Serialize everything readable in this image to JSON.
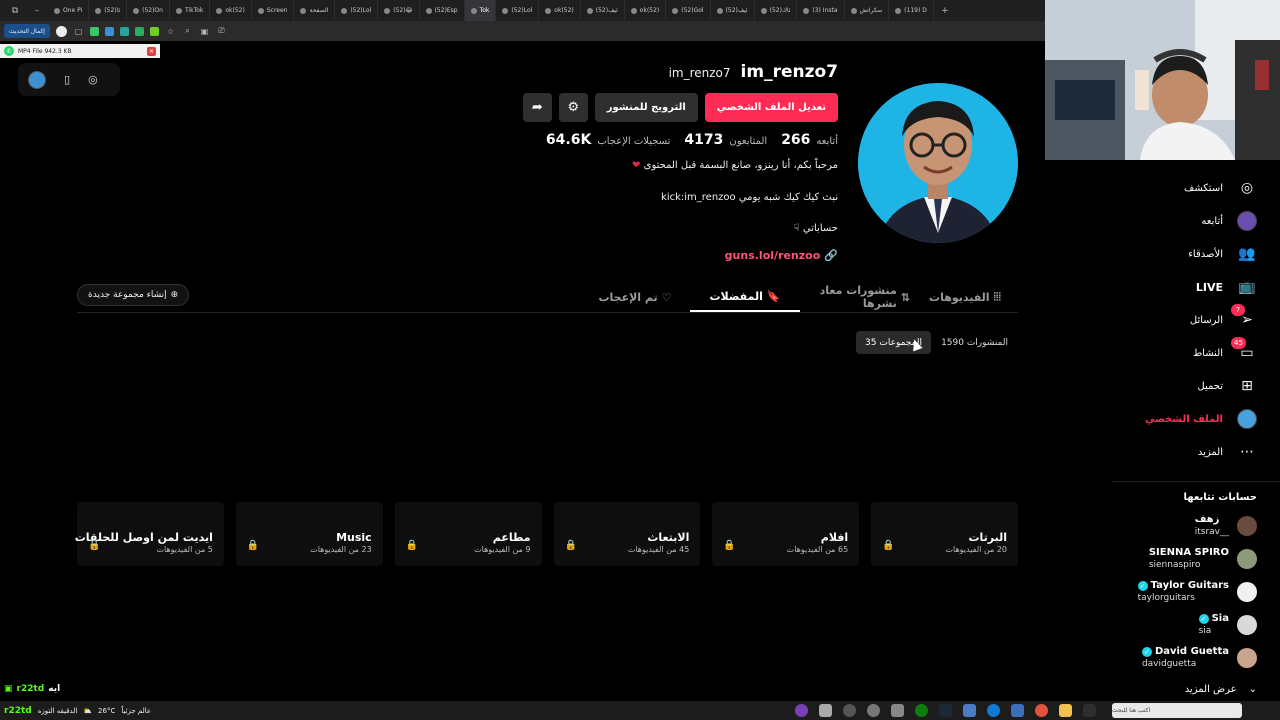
{
  "browser": {
    "tabs": [
      {
        "label": "One Pi"
      },
      {
        "label": "(52)ئا"
      },
      {
        "label": "(52)On"
      },
      {
        "label": "TikTok"
      },
      {
        "label": "ok(52)"
      },
      {
        "label": "Screen"
      },
      {
        "label": "الصفحة"
      },
      {
        "label": "(52)Lol"
      },
      {
        "label": "(52)😂"
      },
      {
        "label": "(52)Esp"
      },
      {
        "label": "Tok",
        "active": true
      },
      {
        "label": "(52)Lol"
      },
      {
        "label": "ok(52)"
      },
      {
        "label": "(52)ئيف"
      },
      {
        "label": "ok(52)"
      },
      {
        "label": "(52)Gol"
      },
      {
        "label": "(52)ئيف"
      },
      {
        "label": "(52)ئاك"
      },
      {
        "label": "(3) Insta"
      },
      {
        "label": "سكراتش"
      },
      {
        "label": "(119) D"
      }
    ],
    "update_label": "إكمال التحديث",
    "download_label": "MP4 File 942.3 KB"
  },
  "profile": {
    "username": "im_renzo7",
    "display_name": "im_renzo7",
    "edit_profile": "تعديل الملف الشخصي",
    "promote_post": "الترويج للمنشور",
    "stats": {
      "following_count": "266",
      "following_label": "أتابعه",
      "followers_count": "4173",
      "followers_label": "المتابعون",
      "likes_count": "64.6K",
      "likes_label": "تسجيلات الإعجاب"
    },
    "bio": {
      "line1": "مرحباً بكم، أنا رينزو، صانع البسمة قبل المحتوى",
      "line2": "نبث كيك كيك شبه يومي kick:im_renzoo",
      "line3": "حساباتي",
      "link": "guns.lol/renzoo"
    }
  },
  "tabs": {
    "videos": "الفيديوهات",
    "reposts": "منشورات معاد نشرها",
    "favorites": "المفضلات",
    "liked": "تم الإعجاب"
  },
  "new_collection": "إنشاء مجموعة جديدة",
  "filters": {
    "posts": "المنشورات 1590",
    "collections": "المجموعات 35"
  },
  "collections": [
    {
      "title": "البرتات",
      "count": "20 من الفيديوهات"
    },
    {
      "title": "افلام",
      "count": "65 من الفيديوهات"
    },
    {
      "title": "الابتعاث",
      "count": "45 من الفيديوهات"
    },
    {
      "title": "مطاعم",
      "count": "9 من الفيديوهات"
    },
    {
      "title": "Music",
      "count": "23 من الفيديوهات"
    },
    {
      "title": "ايديت لمن اوصل للحلقات",
      "count": "5 من الفيديوهات"
    }
  ],
  "sidebar": {
    "explore": "استكشف",
    "following": "أتابعه",
    "friends": "الأصدقاء",
    "live": "LIVE",
    "messages": "الرسائل",
    "messages_badge": "7",
    "activity": "النشاط",
    "activity_badge": "45",
    "upload": "تحميل",
    "profile": "الملف الشخصي",
    "more": "المزيد",
    "following_accounts_title": "حسابات تتابعها",
    "accounts": [
      {
        "name": "زهف",
        "handle": "__itsrav"
      },
      {
        "name": "SIENNA SPIRO",
        "handle": "siennaspiro"
      },
      {
        "name": "Taylor Guitars",
        "handle": "taylorguitars"
      },
      {
        "name": "Sia",
        "handle": "sia"
      },
      {
        "name": "David Guetta",
        "handle": "davidguetta"
      }
    ],
    "see_more": "عرض المزيد"
  },
  "taskbar": {
    "chat_user": "r22td",
    "chat_text": "ايه",
    "stream_user": "r22td",
    "stream_text": "الدقيقه التوزه",
    "weather": "26°C",
    "weather_label": "عالم جزئياً",
    "search_placeholder": "اكتب هنا للبحث"
  },
  "colors": {
    "accent": "#fe2c55",
    "avatar_bg": "#1fb4e6",
    "verified": "#20d5ec",
    "link": "#ff5474"
  }
}
